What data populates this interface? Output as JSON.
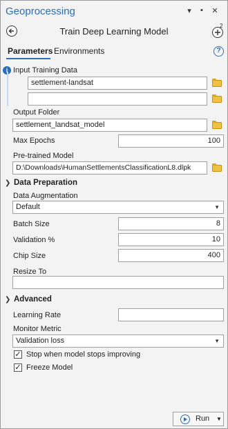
{
  "window": {
    "title": "Geoprocessing",
    "controls": [
      "▾",
      "▪",
      "✕"
    ]
  },
  "tool": {
    "title": "Train Deep Learning Model",
    "back_icon": "arrow-left-icon",
    "add_icon": "add-circle-icon",
    "add_badge": "2"
  },
  "tabs": [
    {
      "label": "Parameters",
      "active": true
    },
    {
      "label": "Environments",
      "active": false
    }
  ],
  "help_icon": "?",
  "params": {
    "input_training_data": {
      "label": "Input Training Data",
      "values": [
        "settlement-landsat",
        ""
      ]
    },
    "output_folder": {
      "label": "Output Folder",
      "value": "settlement_landsat_model"
    },
    "max_epochs": {
      "label": "Max Epochs",
      "value": "100"
    },
    "pretrained_model": {
      "label": "Pre-trained Model",
      "value": "D:\\Downloads\\HumanSettlementsClassificationL8.dlpk"
    }
  },
  "data_preparation": {
    "title": "Data Preparation",
    "data_augmentation": {
      "label": "Data Augmentation",
      "value": "Default"
    },
    "batch_size": {
      "label": "Batch Size",
      "value": "8"
    },
    "validation": {
      "label": "Validation %",
      "value": "10"
    },
    "chip_size": {
      "label": "Chip Size",
      "value": "400"
    },
    "resize_to": {
      "label": "Resize To",
      "value": ""
    }
  },
  "advanced": {
    "title": "Advanced",
    "learning_rate": {
      "label": "Learning Rate",
      "value": ""
    },
    "monitor_metric": {
      "label": "Monitor Metric",
      "value": "Validation loss"
    },
    "stop_checkbox": {
      "label": "Stop when model stops improving",
      "checked": true
    },
    "freeze_checkbox": {
      "label": "Freeze Model",
      "checked": true
    }
  },
  "run": {
    "label": "Run"
  },
  "colors": {
    "accent": "#2a6ebb",
    "folder": "#f0c040"
  }
}
